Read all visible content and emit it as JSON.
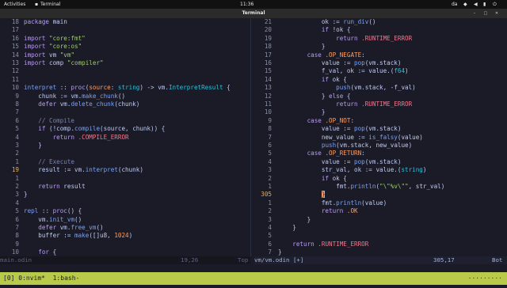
{
  "topbar": {
    "activities": "Activities",
    "app_name": "Terminal",
    "clock": "11:36",
    "lang": "da",
    "icons": [
      "network-icon",
      "volume-icon",
      "battery-icon",
      "power-icon"
    ]
  },
  "terminal": {
    "title": "Terminal"
  },
  "colors": {
    "background": "#1a1b26",
    "keyword": "#bb9af7",
    "string": "#9ece6a",
    "function": "#7aa2f7",
    "constant": "#ff9e64",
    "comment": "#7a83ac",
    "tmux_bar": "#b9ca4a"
  },
  "left_pane": {
    "lines": [
      {
        "n": "18",
        "t": [
          [
            "kw",
            "package "
          ],
          [
            "plain",
            "main"
          ]
        ]
      },
      {
        "n": "17",
        "t": []
      },
      {
        "n": "16",
        "t": [
          [
            "kw",
            "import "
          ],
          [
            "str",
            "\"core:fmt\""
          ]
        ]
      },
      {
        "n": "15",
        "t": [
          [
            "kw",
            "import "
          ],
          [
            "str",
            "\"core:os\""
          ]
        ]
      },
      {
        "n": "14",
        "t": [
          [
            "kw",
            "import "
          ],
          [
            "plain",
            "vm "
          ],
          [
            "str",
            "\"vm\""
          ]
        ]
      },
      {
        "n": "13",
        "t": [
          [
            "kw",
            "import "
          ],
          [
            "plain",
            "comp "
          ],
          [
            "str",
            "\"compiler\""
          ]
        ]
      },
      {
        "n": "12",
        "t": []
      },
      {
        "n": "11",
        "t": []
      },
      {
        "n": "10",
        "t": [
          [
            "fn",
            "interpret"
          ],
          [
            "plain",
            " :: "
          ],
          [
            "kw",
            "proc"
          ],
          [
            "plain",
            "("
          ],
          [
            "const",
            "source"
          ],
          [
            "plain",
            ": "
          ],
          [
            "type",
            "string"
          ],
          [
            "plain",
            ") -> vm."
          ],
          [
            "type",
            "InterpretResult"
          ],
          [
            "plain",
            " {"
          ]
        ]
      },
      {
        "n": "9",
        "t": [
          [
            "plain",
            "    chunk := vm."
          ],
          [
            "fn",
            "make_chunk"
          ],
          [
            "plain",
            "()"
          ]
        ]
      },
      {
        "n": "8",
        "t": [
          [
            "kw",
            "    defer "
          ],
          [
            "plain",
            "vm."
          ],
          [
            "fn",
            "delete_chunk"
          ],
          [
            "plain",
            "(chunk)"
          ]
        ]
      },
      {
        "n": "7",
        "t": []
      },
      {
        "n": "6",
        "t": [
          [
            "com",
            "    // Compile"
          ]
        ]
      },
      {
        "n": "5",
        "t": [
          [
            "kw",
            "    if "
          ],
          [
            "plain",
            "(!comp."
          ],
          [
            "fn",
            "compile"
          ],
          [
            "plain",
            "(source, chunk)) {"
          ]
        ]
      },
      {
        "n": "4",
        "t": [
          [
            "kw",
            "        return "
          ],
          [
            "err",
            ".COMPILE_ERROR"
          ]
        ]
      },
      {
        "n": "3",
        "t": [
          [
            "plain",
            "    }"
          ]
        ]
      },
      {
        "n": "2",
        "t": []
      },
      {
        "n": "1",
        "t": [
          [
            "com",
            "    // Execute"
          ]
        ]
      },
      {
        "n": "19",
        "cur": true,
        "t": [
          [
            "plain",
            "    result := vm."
          ],
          [
            "fn",
            "interpret"
          ],
          [
            "plain",
            "(chunk)"
          ]
        ]
      },
      {
        "n": "1",
        "t": []
      },
      {
        "n": "2",
        "t": [
          [
            "kw",
            "    return "
          ],
          [
            "plain",
            "result"
          ]
        ]
      },
      {
        "n": "3",
        "t": [
          [
            "plain",
            "}"
          ]
        ]
      },
      {
        "n": "4",
        "t": []
      },
      {
        "n": "5",
        "t": [
          [
            "fn",
            "repl"
          ],
          [
            "plain",
            " :: "
          ],
          [
            "kw",
            "proc"
          ],
          [
            "plain",
            "() {"
          ]
        ]
      },
      {
        "n": "6",
        "t": [
          [
            "plain",
            "    vm."
          ],
          [
            "fn",
            "init_vm"
          ],
          [
            "plain",
            "()"
          ]
        ]
      },
      {
        "n": "7",
        "t": [
          [
            "kw",
            "    defer "
          ],
          [
            "plain",
            "vm."
          ],
          [
            "fn",
            "free_vm"
          ],
          [
            "plain",
            "()"
          ]
        ]
      },
      {
        "n": "8",
        "t": [
          [
            "plain",
            "    buffer := "
          ],
          [
            "fn",
            "make"
          ],
          [
            "plain",
            "([]u8, "
          ],
          [
            "const",
            "1024"
          ],
          [
            "plain",
            ")"
          ]
        ]
      },
      {
        "n": "9",
        "t": []
      },
      {
        "n": "10",
        "t": [
          [
            "kw",
            "    for "
          ],
          [
            "plain",
            "{"
          ]
        ]
      }
    ]
  },
  "right_pane": {
    "lines": [
      {
        "n": "21",
        "t": [
          [
            "plain",
            "            ok := "
          ],
          [
            "fn",
            "run_div"
          ],
          [
            "plain",
            "()"
          ]
        ]
      },
      {
        "n": "20",
        "t": [
          [
            "kw",
            "            if "
          ],
          [
            "plain",
            "!ok {"
          ]
        ]
      },
      {
        "n": "19",
        "t": [
          [
            "kw",
            "                return "
          ],
          [
            "err",
            ".RUNTIME_ERROR"
          ]
        ]
      },
      {
        "n": "18",
        "t": [
          [
            "plain",
            "            }"
          ]
        ]
      },
      {
        "n": "17",
        "t": [
          [
            "kw",
            "        case "
          ],
          [
            "const",
            ".OP_NEGATE"
          ],
          [
            "plain",
            ":"
          ]
        ]
      },
      {
        "n": "16",
        "t": [
          [
            "plain",
            "            value := "
          ],
          [
            "fn",
            "pop"
          ],
          [
            "plain",
            "(vm.stack)"
          ]
        ]
      },
      {
        "n": "15",
        "t": [
          [
            "plain",
            "            f_val, ok := value.("
          ],
          [
            "type",
            "f64"
          ],
          [
            "plain",
            ")"
          ]
        ]
      },
      {
        "n": "14",
        "t": [
          [
            "kw",
            "            if "
          ],
          [
            "plain",
            "ok {"
          ]
        ]
      },
      {
        "n": "13",
        "t": [
          [
            "plain",
            "                "
          ],
          [
            "fn",
            "push"
          ],
          [
            "plain",
            "(vm.stack, -f_val)"
          ]
        ]
      },
      {
        "n": "12",
        "t": [
          [
            "plain",
            "            } "
          ],
          [
            "kw",
            "else"
          ],
          [
            "plain",
            " {"
          ]
        ]
      },
      {
        "n": "11",
        "t": [
          [
            "kw",
            "                return "
          ],
          [
            "err",
            ".RUNTIME_ERROR"
          ]
        ]
      },
      {
        "n": "10",
        "t": [
          [
            "plain",
            "            }"
          ]
        ]
      },
      {
        "n": "9",
        "t": [
          [
            "kw",
            "        case "
          ],
          [
            "const",
            ".OP_NOT"
          ],
          [
            "plain",
            ":"
          ]
        ]
      },
      {
        "n": "8",
        "t": [
          [
            "plain",
            "            value := "
          ],
          [
            "fn",
            "pop"
          ],
          [
            "plain",
            "(vm.stack)"
          ]
        ]
      },
      {
        "n": "7",
        "t": [
          [
            "plain",
            "            new_value := "
          ],
          [
            "fn",
            "is_falsy"
          ],
          [
            "plain",
            "(value)"
          ]
        ]
      },
      {
        "n": "6",
        "t": [
          [
            "plain",
            "            "
          ],
          [
            "fn",
            "push"
          ],
          [
            "plain",
            "(vm.stack, new_value)"
          ]
        ]
      },
      {
        "n": "5",
        "t": [
          [
            "kw",
            "        case "
          ],
          [
            "const",
            ".OP_RETURN"
          ],
          [
            "plain",
            ":"
          ]
        ]
      },
      {
        "n": "4",
        "t": [
          [
            "plain",
            "            value := "
          ],
          [
            "fn",
            "pop"
          ],
          [
            "plain",
            "(vm.stack)"
          ]
        ]
      },
      {
        "n": "3",
        "t": [
          [
            "plain",
            "            str_val, ok := value.("
          ],
          [
            "type",
            "string"
          ],
          [
            "plain",
            ")"
          ]
        ]
      },
      {
        "n": "2",
        "t": [
          [
            "kw",
            "            if "
          ],
          [
            "plain",
            "ok {"
          ]
        ]
      },
      {
        "n": "1",
        "t": [
          [
            "plain",
            "                fmt."
          ],
          [
            "fn",
            "println"
          ],
          [
            "plain",
            "("
          ],
          [
            "str",
            "\"\\\"%v\\\"\""
          ],
          [
            "plain",
            ", str_val)"
          ]
        ]
      },
      {
        "n": "305",
        "cur": true,
        "t": [
          [
            "plain",
            "            "
          ],
          [
            "cursor",
            "}"
          ]
        ]
      },
      {
        "n": "1",
        "t": [
          [
            "plain",
            "            fmt."
          ],
          [
            "fn",
            "println"
          ],
          [
            "plain",
            "(value)"
          ]
        ]
      },
      {
        "n": "2",
        "t": [
          [
            "kw",
            "            return "
          ],
          [
            "const",
            ".OK"
          ]
        ]
      },
      {
        "n": "3",
        "t": [
          [
            "plain",
            "        }"
          ]
        ]
      },
      {
        "n": "4",
        "t": [
          [
            "plain",
            "    }"
          ]
        ]
      },
      {
        "n": "5",
        "t": []
      },
      {
        "n": "6",
        "t": [
          [
            "kw",
            "    return "
          ],
          [
            "err",
            ".RUNTIME_ERROR"
          ]
        ]
      },
      {
        "n": "7",
        "t": [
          [
            "plain",
            "}"
          ]
        ]
      }
    ]
  },
  "status_left": {
    "file": "main.odin",
    "position": "19,26",
    "scroll": "Top"
  },
  "status_right": {
    "file": "vm/vm.odin [+]",
    "position": "305,17",
    "scroll": "Bot"
  },
  "tmux": {
    "session": "[0] 0:nvim*  1:bash-",
    "dots": "·········"
  }
}
